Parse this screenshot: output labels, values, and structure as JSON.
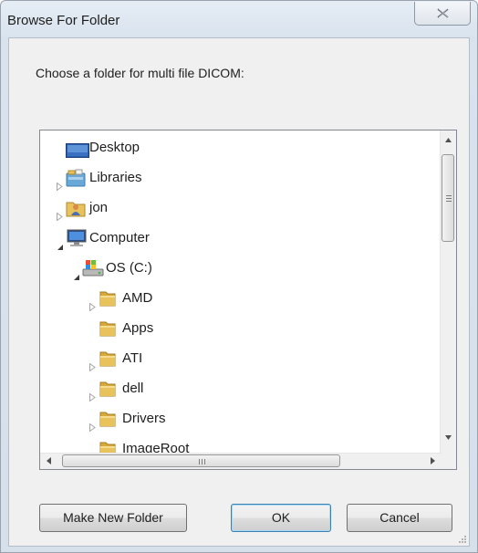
{
  "window": {
    "title": "Browse For Folder"
  },
  "dialog": {
    "prompt": "Choose a folder for multi file DICOM:"
  },
  "tree": {
    "items": [
      {
        "label": "Desktop",
        "icon": "desktop-icon",
        "arrow": "none",
        "level": 0
      },
      {
        "label": "Libraries",
        "icon": "libraries-icon",
        "arrow": "collapsed",
        "level": 0
      },
      {
        "label": "jon",
        "icon": "user-folder-icon",
        "arrow": "collapsed",
        "level": 0
      },
      {
        "label": "Computer",
        "icon": "computer-icon",
        "arrow": "expanded",
        "level": 0
      },
      {
        "label": "OS (C:)",
        "icon": "drive-icon",
        "arrow": "expanded",
        "level": 1
      },
      {
        "label": "AMD",
        "icon": "folder-icon",
        "arrow": "collapsed",
        "level": 2
      },
      {
        "label": "Apps",
        "icon": "folder-icon",
        "arrow": "none",
        "level": 2
      },
      {
        "label": "ATI",
        "icon": "folder-icon",
        "arrow": "collapsed",
        "level": 2
      },
      {
        "label": "dell",
        "icon": "folder-icon",
        "arrow": "collapsed",
        "level": 2
      },
      {
        "label": "Drivers",
        "icon": "folder-icon",
        "arrow": "collapsed",
        "level": 2
      },
      {
        "label": "ImageRoot",
        "icon": "folder-icon",
        "arrow": "collapsed",
        "level": 2
      }
    ]
  },
  "buttons": {
    "make_new_folder": "Make New Folder",
    "ok": "OK",
    "cancel": "Cancel"
  },
  "colors": {
    "folder": "#e8c25a",
    "accent": "#3c7fb1"
  }
}
